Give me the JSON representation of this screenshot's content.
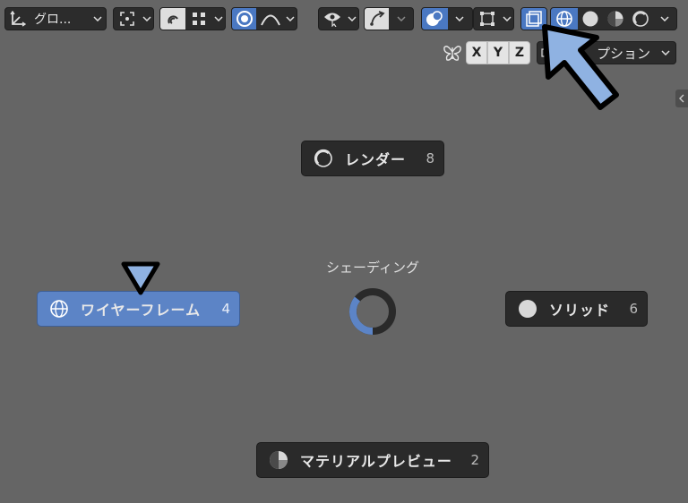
{
  "header": {
    "transform_orientation_label": "グロ...",
    "options_label": "プション"
  },
  "axes": {
    "x": "X",
    "y": "Y",
    "z": "Z"
  },
  "pie_menu": {
    "title": "シェーディング",
    "items": [
      {
        "label": "レンダー",
        "shortcut": "8"
      },
      {
        "label": "ワイヤーフレーム",
        "shortcut": "4"
      },
      {
        "label": "ソリッド",
        "shortcut": "6"
      },
      {
        "label": "マテリアルプレビュー",
        "shortcut": "2"
      }
    ],
    "active_item": "ワイヤーフレーム"
  },
  "colors": {
    "accent": "#5c84c6",
    "annotation_arrow": "#8fb2e2",
    "background": "#656565"
  }
}
